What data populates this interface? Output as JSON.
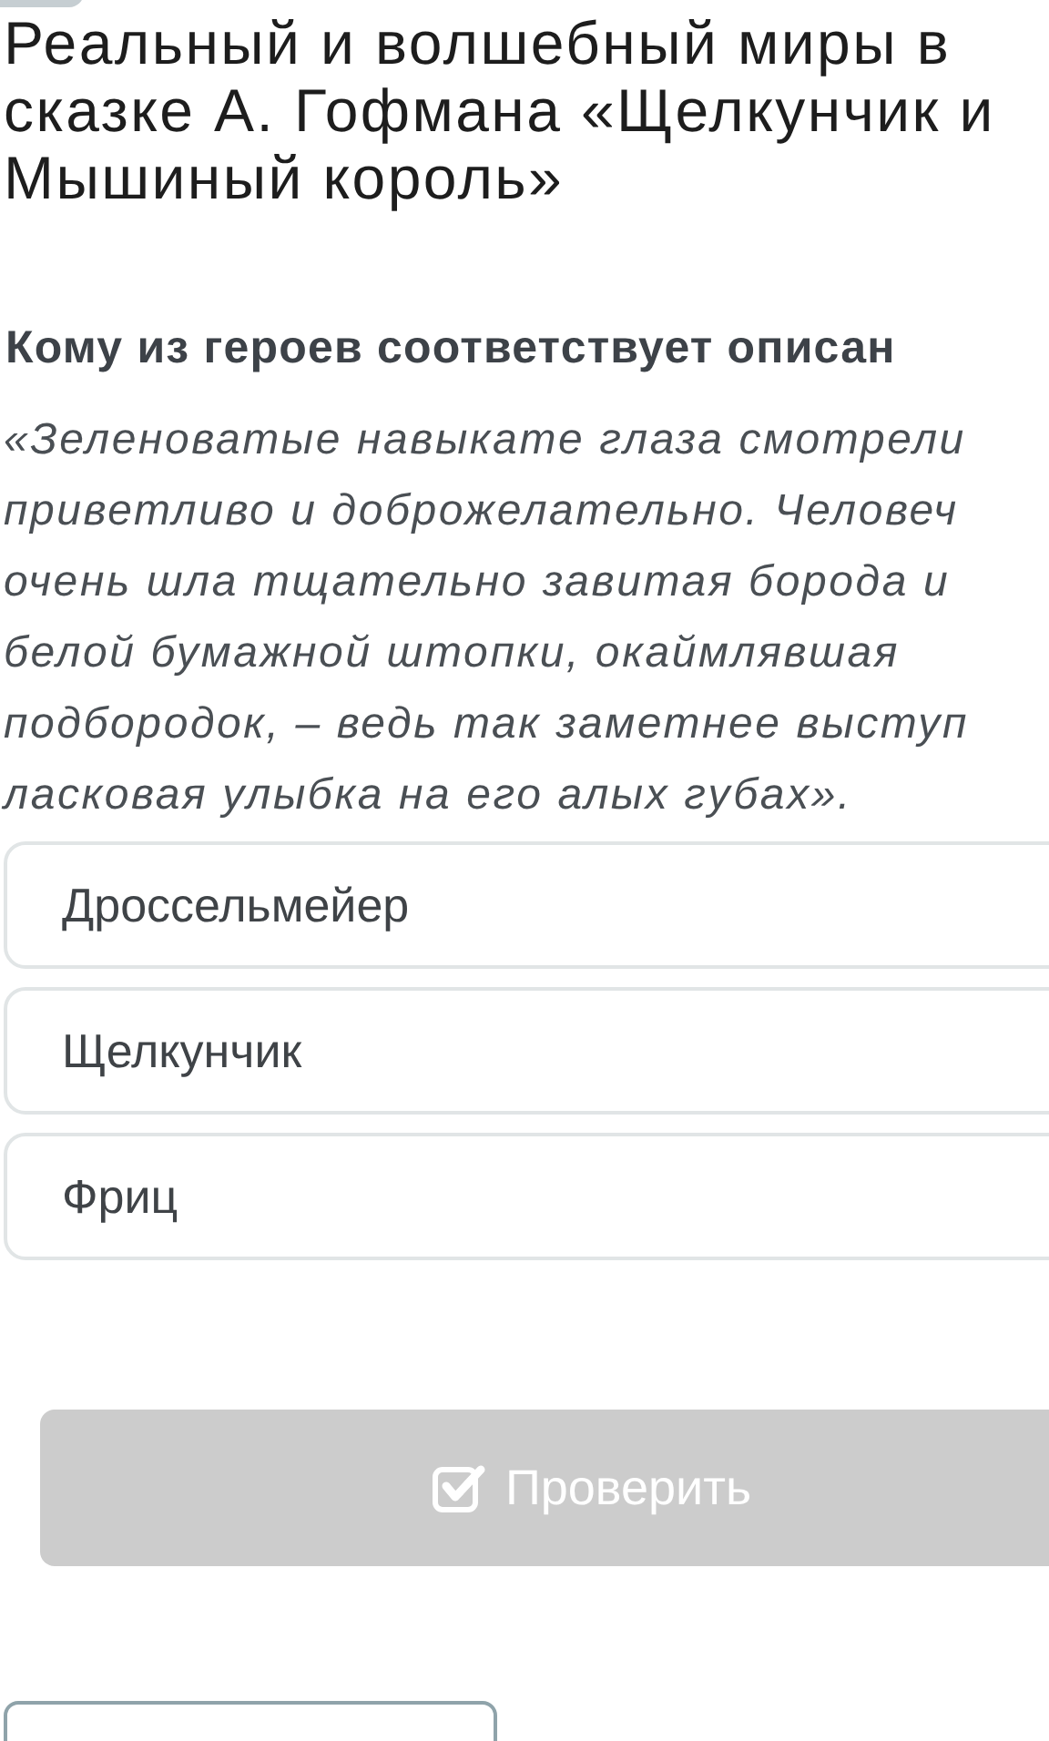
{
  "title_lines": [
    "Реальный и волшебный миры в",
    "сказке А. Гофмана «Щелкунчик и",
    "Мышиный король»"
  ],
  "question": "Кому из героев соответствует описан",
  "quote_lines": [
    "«Зеленоватые навыкате глаза смотрели",
    "приветливо и доброжелательно. Человеч",
    "очень шла тщательно завитая борода и",
    "белой бумажной штопки, окаймлявшая",
    "подбородок, – ведь так заметнее выступ",
    "ласковая улыбка на его алых губах»."
  ],
  "options": [
    {
      "label": "Дроссельмейер",
      "selected": false
    },
    {
      "label": "Щелкунчик",
      "selected": false
    },
    {
      "label": "Фриц",
      "selected": false
    }
  ],
  "check_button": {
    "label": "Проверить",
    "disabled": true
  }
}
